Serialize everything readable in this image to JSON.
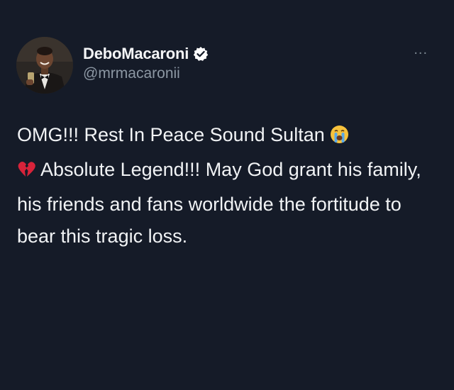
{
  "tweet": {
    "author": {
      "display_name": "DeboMacaroni",
      "handle": "@mrmacaronii",
      "verified": true,
      "avatar": "avatar-photo"
    },
    "more_menu": "...",
    "text_part1": "OMG!!! Rest In Peace Sound Sultan ",
    "emoji1": "loudly-crying-face",
    "emoji2": "broken-heart",
    "text_part2": " Absolute Legend!!! May God grant his family, his friends and fans worldwide the fortitude to bear this tragic loss."
  },
  "colors": {
    "background": "#151b28",
    "text": "#f1f3f5",
    "handle": "#8c97a3",
    "verified": "#ffffff"
  }
}
